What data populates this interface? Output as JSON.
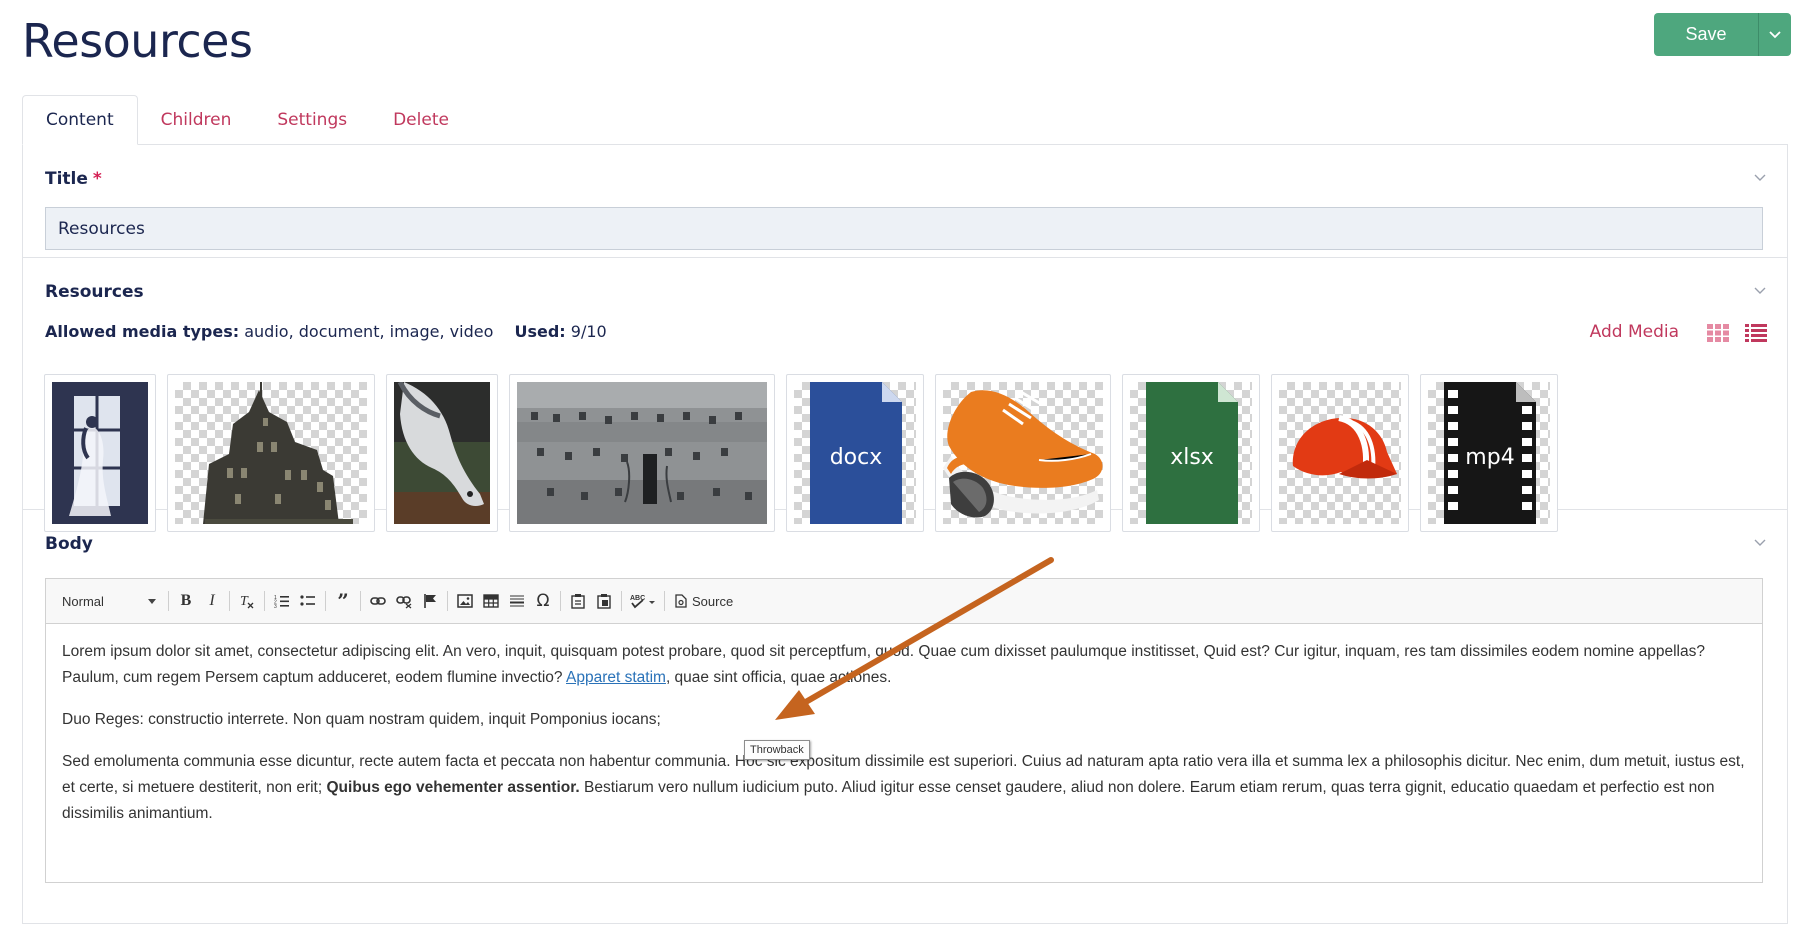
{
  "page": {
    "title": "Resources"
  },
  "header": {
    "save_label": "Save"
  },
  "tabs": [
    {
      "label": "Content",
      "active": true
    },
    {
      "label": "Children"
    },
    {
      "label": "Settings"
    },
    {
      "label": "Delete"
    }
  ],
  "title_field": {
    "label": "Title",
    "required_mark": "*",
    "value": "Resources"
  },
  "resources": {
    "label": "Resources",
    "allowed_label": "Allowed media types:",
    "allowed_value": "audio, document, image, video",
    "used_label": "Used:",
    "used_value": "9/10",
    "add_media_label": "Add Media",
    "items": [
      {
        "kind": "image",
        "subject": "woman-at-window"
      },
      {
        "kind": "image",
        "subject": "haunted-house"
      },
      {
        "kind": "image",
        "subject": "white-horse"
      },
      {
        "kind": "image",
        "subject": "old-building"
      },
      {
        "kind": "document",
        "label": "docx"
      },
      {
        "kind": "image",
        "subject": "orange-sneakers"
      },
      {
        "kind": "document",
        "label": "xlsx"
      },
      {
        "kind": "image",
        "subject": "red-cap"
      },
      {
        "kind": "video",
        "label": "mp4"
      }
    ]
  },
  "body": {
    "label": "Body",
    "toolbar": {
      "format_value": "Normal",
      "source_label": "Source"
    },
    "paragraphs": [
      {
        "text_before": "Lorem ipsum dolor sit amet, consectetur adipiscing elit. An vero, inquit, quisquam potest probare, quod sit perceptfum, quod. Quae cum dixisset paulumque institisset, Quid est? Cur igitur, inquam, res tam dissimiles eodem nomine appellas? Paulum, cum regem Persem captum adduceret, eodem flumine invectio? ",
        "link": "Apparet statim",
        "text_after": ", quae sint officia, quae actiones."
      },
      {
        "text": "Duo Reges: constructio interrete. Non quam nostram quidem, inquit Pomponius iocans;"
      },
      {
        "text_before": "Sed emolumenta communia esse dicuntur, recte autem facta et peccata non habentur communia. Hoc sic expositum dissimile est superiori. Cuius ad naturam apta ratio vera illa et summa lex a philosophis dicitur. Nec enim, dum metuit, iustus est, et certe, si metuere destiterit, non erit; ",
        "bold": "Quibus ego vehementer assentior.",
        "text_after": " Bestiarum vero nullum iudicium puto. Aliud igitur esse censet gaudere, aliud non dolere. Earum etiam rerum, quas terra gignit, educatio quaedam et perfectio est non dissimilis animantium."
      }
    ],
    "tooltip": "Throwback"
  },
  "colors": {
    "accent": "#c0385d",
    "save_green": "#4ea77e",
    "navy": "#1b264f",
    "docx_blue": "#2b4f9a",
    "xlsx_green": "#2e7040",
    "annotation_arrow": "#c5641f"
  }
}
